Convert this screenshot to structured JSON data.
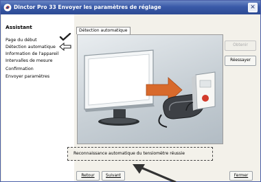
{
  "window": {
    "title": "Dinctor Pro 33 Envoyer les paramètres de réglage",
    "close_glyph": "✕",
    "title_icon": "app-logo-icon"
  },
  "sidebar": {
    "heading": "Assistant",
    "items": [
      {
        "label": "Page du début",
        "marker": "checkmark-icon"
      },
      {
        "label": "Détection automatique",
        "marker": "arrow-left-icon",
        "current": true
      },
      {
        "label": "Information de l'appareil"
      },
      {
        "label": "Intervalles de mesure"
      },
      {
        "label": "Confirmation"
      },
      {
        "label": "Envoyer paramètres"
      }
    ]
  },
  "main": {
    "tab_label": "Détection automatique",
    "side_buttons": [
      {
        "label": "Obtenir",
        "enabled": false
      },
      {
        "label": "Réessayer",
        "enabled": true
      }
    ],
    "status_message": "Reconnaissance automatique du tensiomètre réussie",
    "illustration": {
      "description_icons": [
        "monitor-icon",
        "transfer-arrow-icon",
        "blood-pressure-monitor-icon"
      ],
      "arrow_color": "#d86a2c"
    }
  },
  "footer": {
    "back_label": "Retour",
    "next_label": "Suivant",
    "close_label": "Fermer"
  },
  "colors": {
    "titlebar": "#3a5aa8",
    "background": "#ece9d8",
    "arrow": "#d86a2c"
  }
}
